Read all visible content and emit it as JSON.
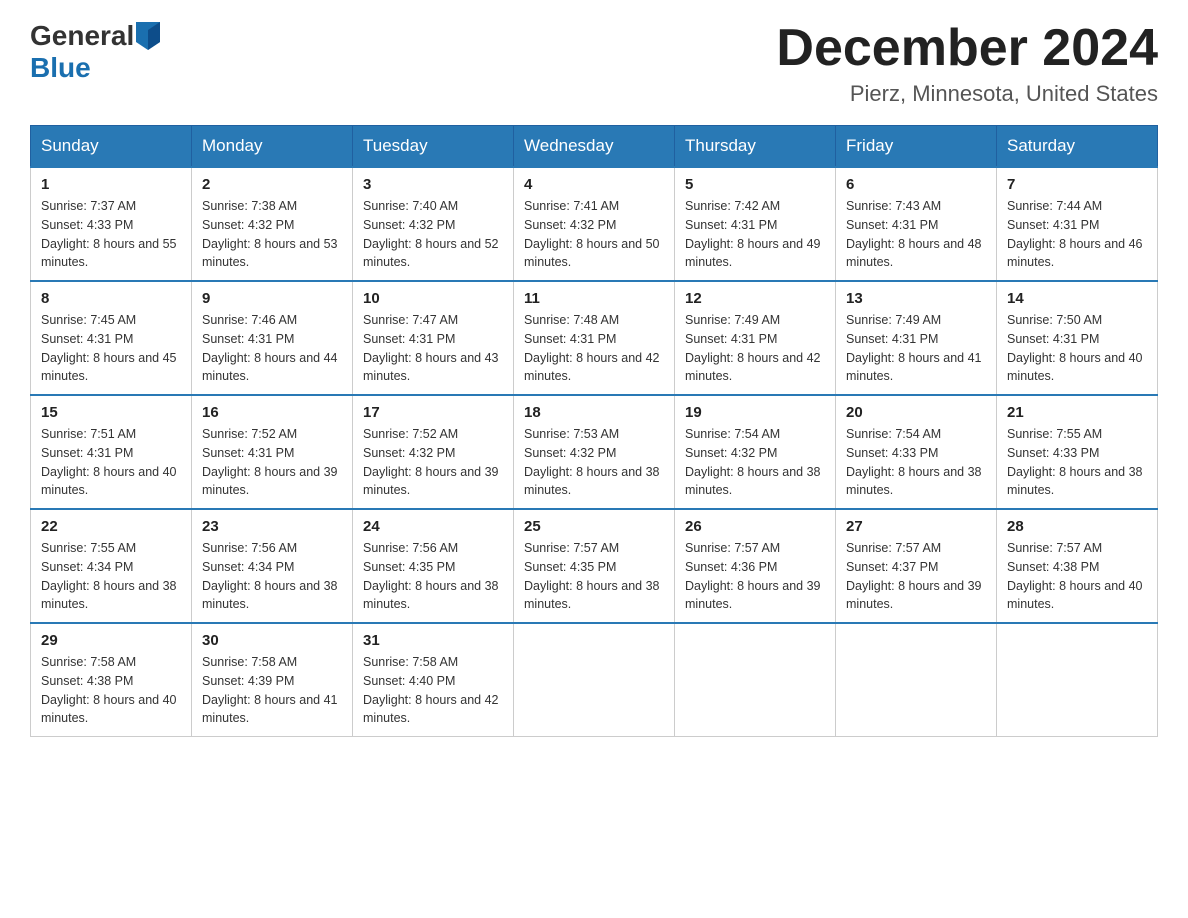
{
  "header": {
    "logo_general": "General",
    "logo_blue": "Blue",
    "month_title": "December 2024",
    "location": "Pierz, Minnesota, United States"
  },
  "days_of_week": [
    "Sunday",
    "Monday",
    "Tuesday",
    "Wednesday",
    "Thursday",
    "Friday",
    "Saturday"
  ],
  "weeks": [
    [
      {
        "day": "1",
        "sunrise": "7:37 AM",
        "sunset": "4:33 PM",
        "daylight": "8 hours and 55 minutes."
      },
      {
        "day": "2",
        "sunrise": "7:38 AM",
        "sunset": "4:32 PM",
        "daylight": "8 hours and 53 minutes."
      },
      {
        "day": "3",
        "sunrise": "7:40 AM",
        "sunset": "4:32 PM",
        "daylight": "8 hours and 52 minutes."
      },
      {
        "day": "4",
        "sunrise": "7:41 AM",
        "sunset": "4:32 PM",
        "daylight": "8 hours and 50 minutes."
      },
      {
        "day": "5",
        "sunrise": "7:42 AM",
        "sunset": "4:31 PM",
        "daylight": "8 hours and 49 minutes."
      },
      {
        "day": "6",
        "sunrise": "7:43 AM",
        "sunset": "4:31 PM",
        "daylight": "8 hours and 48 minutes."
      },
      {
        "day": "7",
        "sunrise": "7:44 AM",
        "sunset": "4:31 PM",
        "daylight": "8 hours and 46 minutes."
      }
    ],
    [
      {
        "day": "8",
        "sunrise": "7:45 AM",
        "sunset": "4:31 PM",
        "daylight": "8 hours and 45 minutes."
      },
      {
        "day": "9",
        "sunrise": "7:46 AM",
        "sunset": "4:31 PM",
        "daylight": "8 hours and 44 minutes."
      },
      {
        "day": "10",
        "sunrise": "7:47 AM",
        "sunset": "4:31 PM",
        "daylight": "8 hours and 43 minutes."
      },
      {
        "day": "11",
        "sunrise": "7:48 AM",
        "sunset": "4:31 PM",
        "daylight": "8 hours and 42 minutes."
      },
      {
        "day": "12",
        "sunrise": "7:49 AM",
        "sunset": "4:31 PM",
        "daylight": "8 hours and 42 minutes."
      },
      {
        "day": "13",
        "sunrise": "7:49 AM",
        "sunset": "4:31 PM",
        "daylight": "8 hours and 41 minutes."
      },
      {
        "day": "14",
        "sunrise": "7:50 AM",
        "sunset": "4:31 PM",
        "daylight": "8 hours and 40 minutes."
      }
    ],
    [
      {
        "day": "15",
        "sunrise": "7:51 AM",
        "sunset": "4:31 PM",
        "daylight": "8 hours and 40 minutes."
      },
      {
        "day": "16",
        "sunrise": "7:52 AM",
        "sunset": "4:31 PM",
        "daylight": "8 hours and 39 minutes."
      },
      {
        "day": "17",
        "sunrise": "7:52 AM",
        "sunset": "4:32 PM",
        "daylight": "8 hours and 39 minutes."
      },
      {
        "day": "18",
        "sunrise": "7:53 AM",
        "sunset": "4:32 PM",
        "daylight": "8 hours and 38 minutes."
      },
      {
        "day": "19",
        "sunrise": "7:54 AM",
        "sunset": "4:32 PM",
        "daylight": "8 hours and 38 minutes."
      },
      {
        "day": "20",
        "sunrise": "7:54 AM",
        "sunset": "4:33 PM",
        "daylight": "8 hours and 38 minutes."
      },
      {
        "day": "21",
        "sunrise": "7:55 AM",
        "sunset": "4:33 PM",
        "daylight": "8 hours and 38 minutes."
      }
    ],
    [
      {
        "day": "22",
        "sunrise": "7:55 AM",
        "sunset": "4:34 PM",
        "daylight": "8 hours and 38 minutes."
      },
      {
        "day": "23",
        "sunrise": "7:56 AM",
        "sunset": "4:34 PM",
        "daylight": "8 hours and 38 minutes."
      },
      {
        "day": "24",
        "sunrise": "7:56 AM",
        "sunset": "4:35 PM",
        "daylight": "8 hours and 38 minutes."
      },
      {
        "day": "25",
        "sunrise": "7:57 AM",
        "sunset": "4:35 PM",
        "daylight": "8 hours and 38 minutes."
      },
      {
        "day": "26",
        "sunrise": "7:57 AM",
        "sunset": "4:36 PM",
        "daylight": "8 hours and 39 minutes."
      },
      {
        "day": "27",
        "sunrise": "7:57 AM",
        "sunset": "4:37 PM",
        "daylight": "8 hours and 39 minutes."
      },
      {
        "day": "28",
        "sunrise": "7:57 AM",
        "sunset": "4:38 PM",
        "daylight": "8 hours and 40 minutes."
      }
    ],
    [
      {
        "day": "29",
        "sunrise": "7:58 AM",
        "sunset": "4:38 PM",
        "daylight": "8 hours and 40 minutes."
      },
      {
        "day": "30",
        "sunrise": "7:58 AM",
        "sunset": "4:39 PM",
        "daylight": "8 hours and 41 minutes."
      },
      {
        "day": "31",
        "sunrise": "7:58 AM",
        "sunset": "4:40 PM",
        "daylight": "8 hours and 42 minutes."
      },
      null,
      null,
      null,
      null
    ]
  ]
}
